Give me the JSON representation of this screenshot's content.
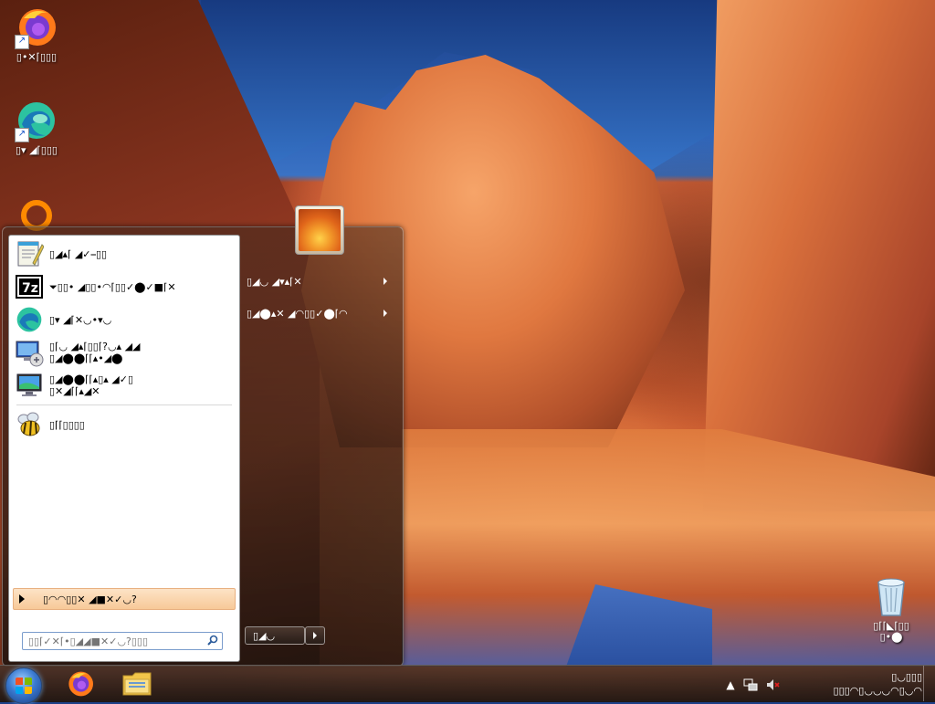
{
  "desktop": {
    "icons": [
      {
        "label": "▯•✕⌈▯▯▯"
      },
      {
        "label": "▯▾ ◢⌈▯▯▯"
      },
      {
        "label": ""
      }
    ],
    "recycle_bin": {
      "label": "▯⌈⌈◣⌈▯▯\n▯•⬤"
    }
  },
  "start_menu": {
    "programs": [
      {
        "label": "▯◢▴⌈ ◢✓⎯▯▯",
        "icon": "notepad-icon"
      },
      {
        "label": "⏷▯▯• ◢▯▯•◠⌈▯▯✓⬤✓■⌈✕",
        "icon": "7zip-icon"
      },
      {
        "label": "▯▾ ◢⌈✕◡•▾◡",
        "icon": "edge-icon"
      },
      {
        "label": "▯⌈◡ ◢▴⌈▯▯⌈?◡▴ ◢◢\n▯◢⬤⬤⌈⌈▴•◢⬤",
        "icon": "remote-desktop-icon"
      },
      {
        "label": "▯◢⬤⬤⌈⌈▴▯▴ ◢✓▯\n▯✕◢⌈⌈▴◢✕",
        "icon": "monitor-icon"
      },
      {
        "label": "▯⌈⌈▯▯▯▯",
        "icon": "bee-icon"
      }
    ],
    "all_programs": "▯◠◠▯▯✕ ◢■✕✓◡?",
    "search_placeholder": "▯▯⌈✓✕⌈•▯◢◢■✕✓◡?▯▯▯",
    "right_items": [
      {
        "label": "▯◢◡ ◢▾▴⌈✕"
      },
      {
        "label": "▯◢⬤▴✕ ◢◠▯▯✓⬤⌈◠"
      }
    ],
    "shutdown_label": "▯◢◡"
  },
  "taskbar": {
    "clock_time": "▯◡▯▯▯",
    "clock_date": "▯▯▯◠▯◡◡◡◠▯◡◠"
  }
}
